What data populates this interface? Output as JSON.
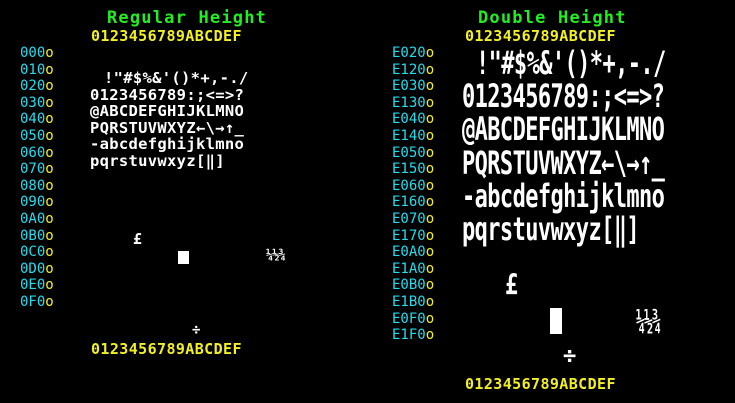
{
  "regular": {
    "title": "Regular Height",
    "hex_header": "0123456789ABCDEF",
    "hex_footer": "0123456789ABCDEF",
    "row_labels": [
      "000",
      "010",
      "020",
      "030",
      "040",
      "050",
      "060",
      "070",
      "080",
      "090",
      "0A0",
      "0B0",
      "0C0",
      "0D0",
      "0E0",
      "0F0"
    ],
    "glyph_rows": [
      "!\"#$%&'()*+,-./",
      "0123456789:;<=>?",
      "@ABCDEFGHIJKLMNO",
      "PQRSTUVWXYZ←\\→↑_",
      "-abcdefghijklmno",
      "pqrstuvwxyz[‖]"
    ],
    "specials": {
      "pound": "£",
      "fractions": "¼½¾",
      "divide": "÷"
    }
  },
  "double": {
    "title": "Double Height",
    "hex_header": "0123456789ABCDEF",
    "hex_footer": "0123456789ABCDEF",
    "row_labels": [
      "E020",
      "E120",
      "E030",
      "E130",
      "E040",
      "E140",
      "E050",
      "E150",
      "E060",
      "E160",
      "E070",
      "E170",
      "E0A0",
      "E1A0",
      "E0B0",
      "E1B0",
      "E0F0",
      "E1F0"
    ],
    "glyph_rows": [
      "!\"#$%&'()*+,-./",
      "0123456789:;<=>?",
      "@ABCDEFGHIJKLMNO",
      "PQRSTUVWXYZ←\\→↑_",
      "-abcdefghijklmno",
      "pqrstuvwxyz[‖]"
    ],
    "specials": {
      "pound": "£",
      "fractions": "¼½¾",
      "divide": "÷"
    }
  },
  "colors": {
    "background": "#000000",
    "title": "#22ee22",
    "hex": "#f2ef22",
    "label": "#22ddee",
    "glyph": "#ffffff"
  }
}
